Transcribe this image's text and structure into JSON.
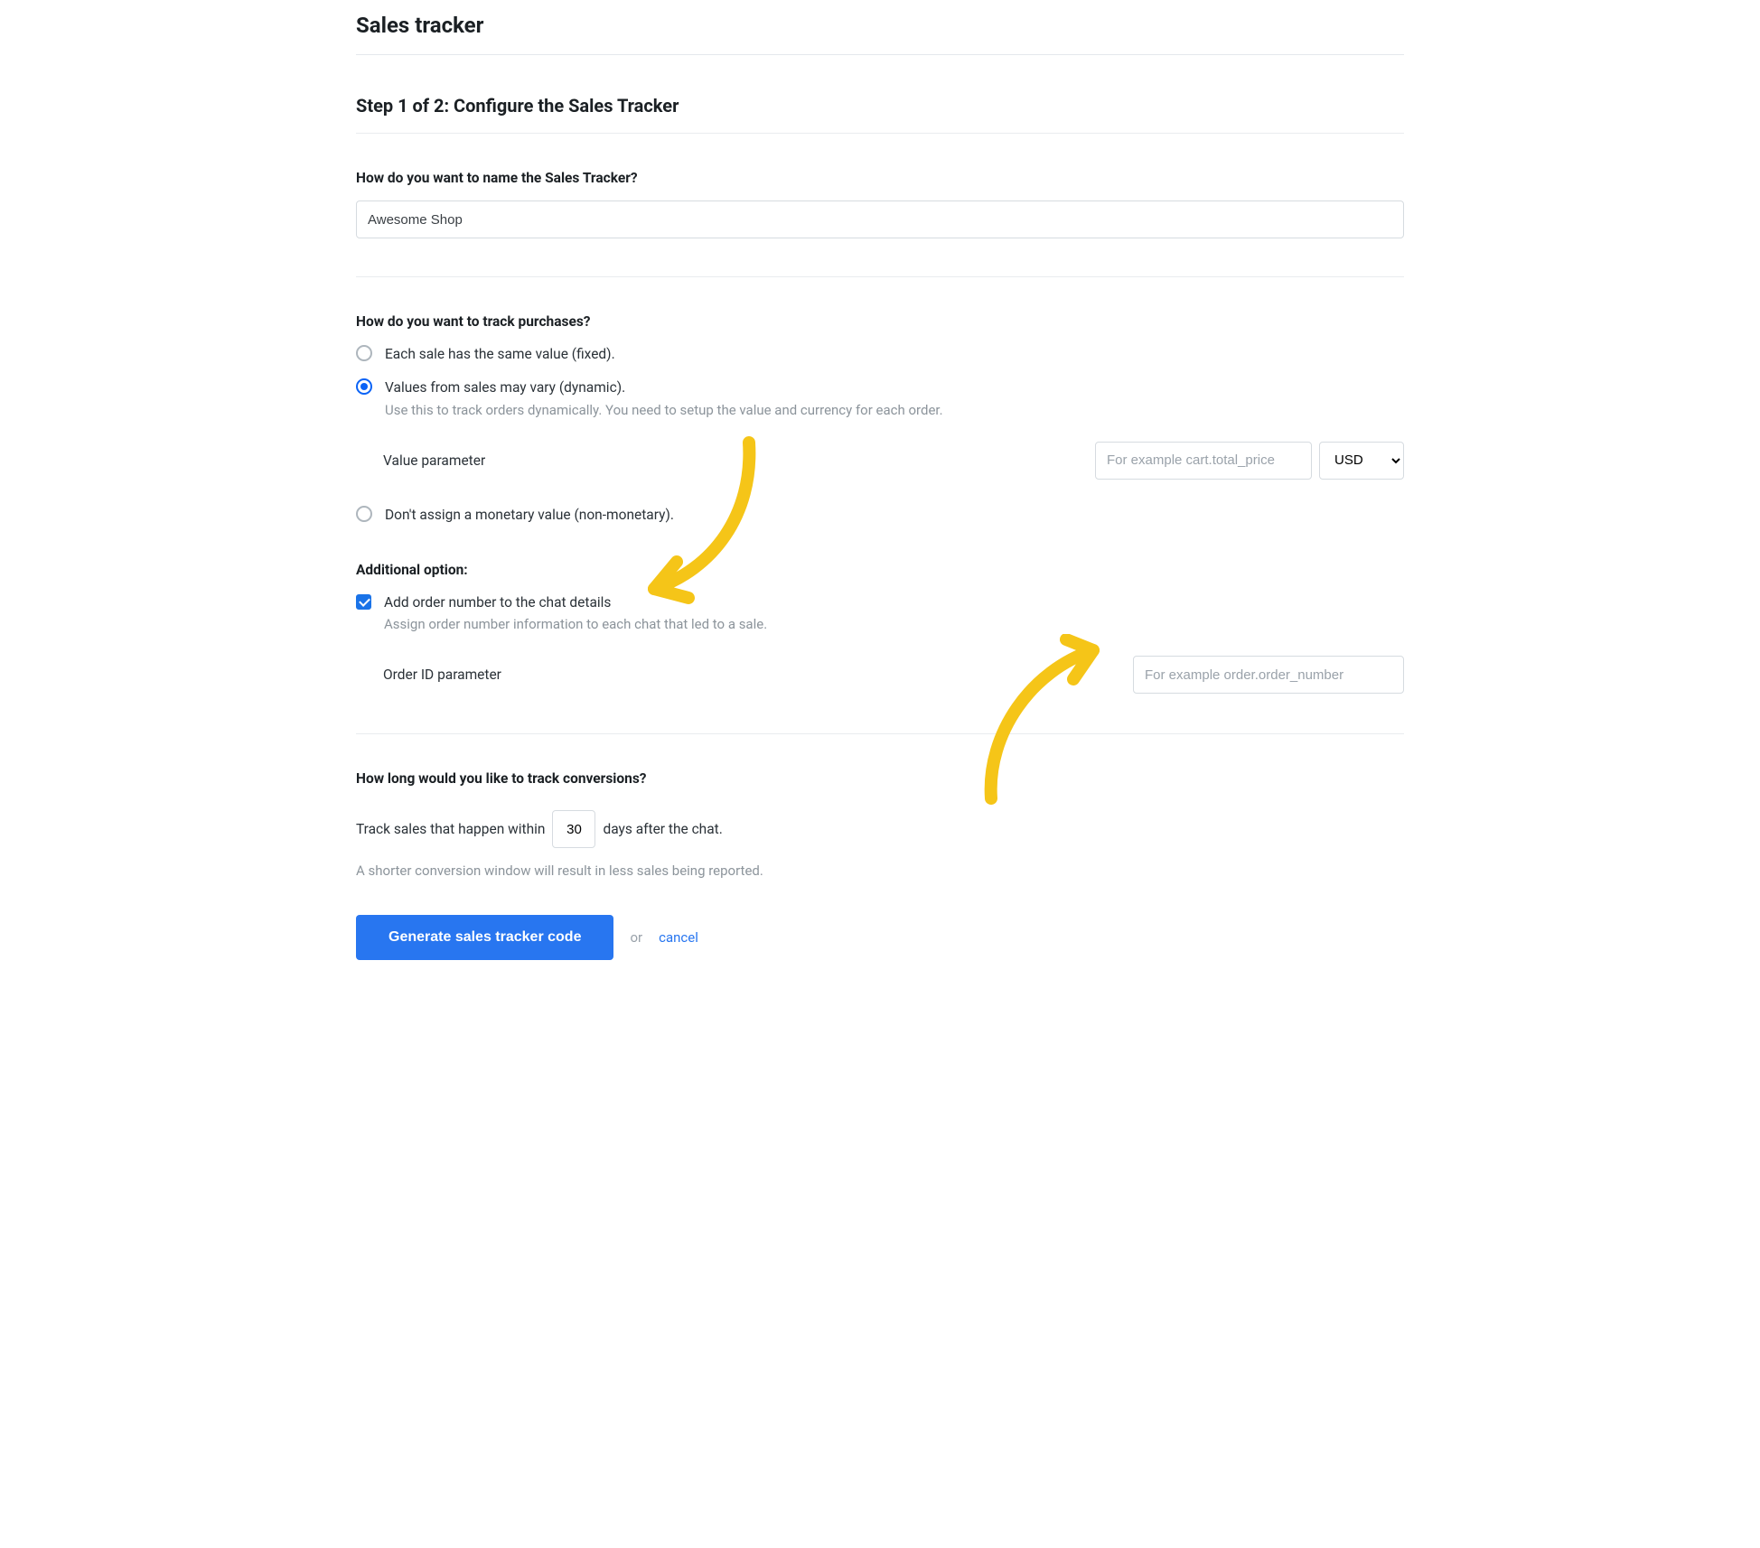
{
  "header": {
    "title": "Sales tracker"
  },
  "step": {
    "title": "Step 1 of 2: Configure the Sales Tracker"
  },
  "name": {
    "question": "How do you want to name the Sales Tracker?",
    "value": "Awesome Shop"
  },
  "track": {
    "question": "How do you want to track purchases?",
    "options": {
      "fixed": "Each sale has the same value (fixed).",
      "dynamic": "Values from sales may vary (dynamic).",
      "dynamic_note": "Use this to track orders dynamically. You need to setup the value and currency for each order.",
      "nonmonetary": "Don't assign a monetary value (non-monetary)."
    },
    "value_param_label": "Value parameter",
    "value_param_placeholder": "For example cart.total_price",
    "currency": "USD"
  },
  "additional": {
    "header": "Additional option:",
    "checkbox_label": "Add order number to the chat details",
    "checkbox_note": "Assign order number information to each chat that led to a sale.",
    "orderid_label": "Order ID parameter",
    "orderid_placeholder": "For example order.order_number"
  },
  "conversion": {
    "question": "How long would you like to track conversions?",
    "sentence_before": "Track sales that happen within",
    "days": "30",
    "sentence_after": "days after the chat.",
    "hint": "A shorter conversion window will result in less sales being reported."
  },
  "actions": {
    "generate": "Generate sales tracker code",
    "or": "or",
    "cancel": "cancel"
  },
  "colors": {
    "accent": "#2876f0",
    "arrow": "#f5c518"
  }
}
